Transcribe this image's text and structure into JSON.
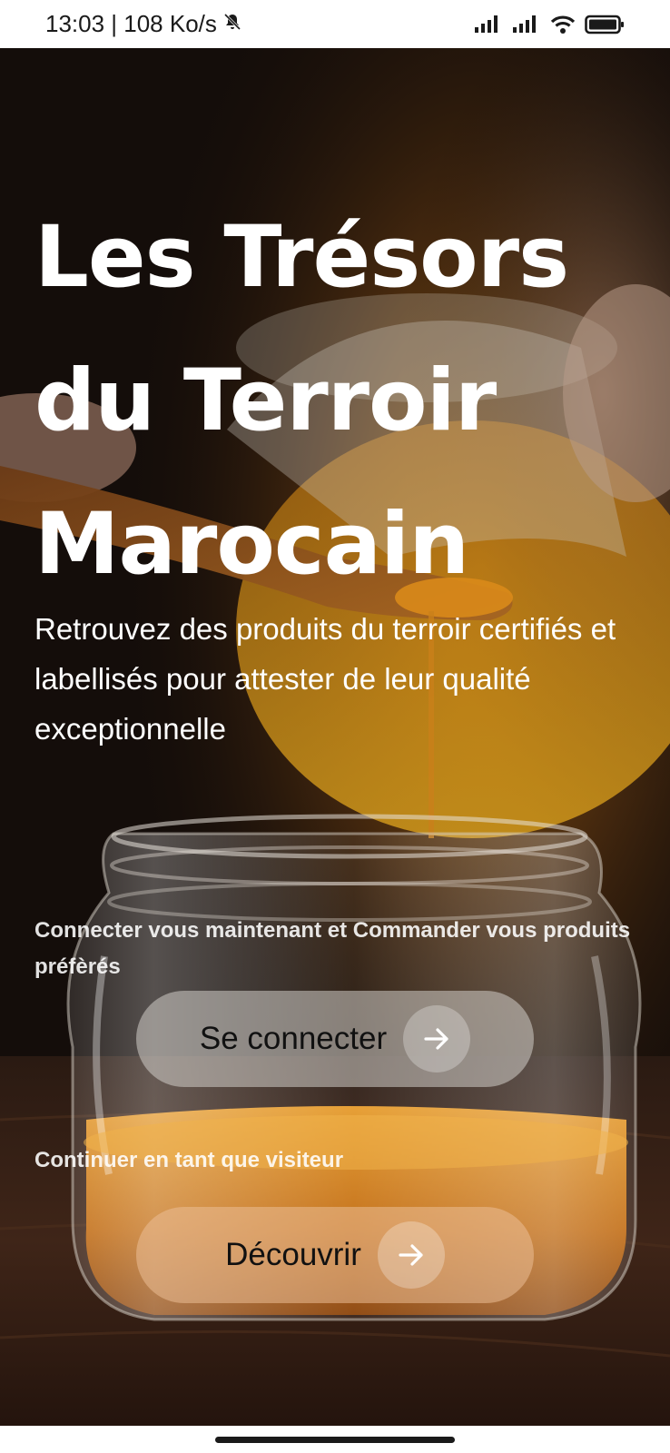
{
  "status_bar": {
    "time_speed": "13:03 | 108 Ko/s",
    "icons": [
      "silent-bell-icon",
      "signal-icon",
      "signal-icon",
      "wifi-icon",
      "battery-icon"
    ]
  },
  "hero": {
    "title": "Les Trésors du Terroir Marocain",
    "subtitle": "Retrouvez des produits du terroir certifiés et labellisés pour attester de leur qualité exceptionnelle",
    "login_prompt": "Connecter vous maintenant et Commander vous produits préfèrés",
    "login_button": "Se connecter",
    "visitor_prompt": "Continuer en tant que visiteur",
    "discover_button": "Découvrir"
  },
  "colors": {
    "text": "#ffffff",
    "button_text": "#111111",
    "honey": "#d98a1a",
    "background_dark": "#140d0a"
  }
}
